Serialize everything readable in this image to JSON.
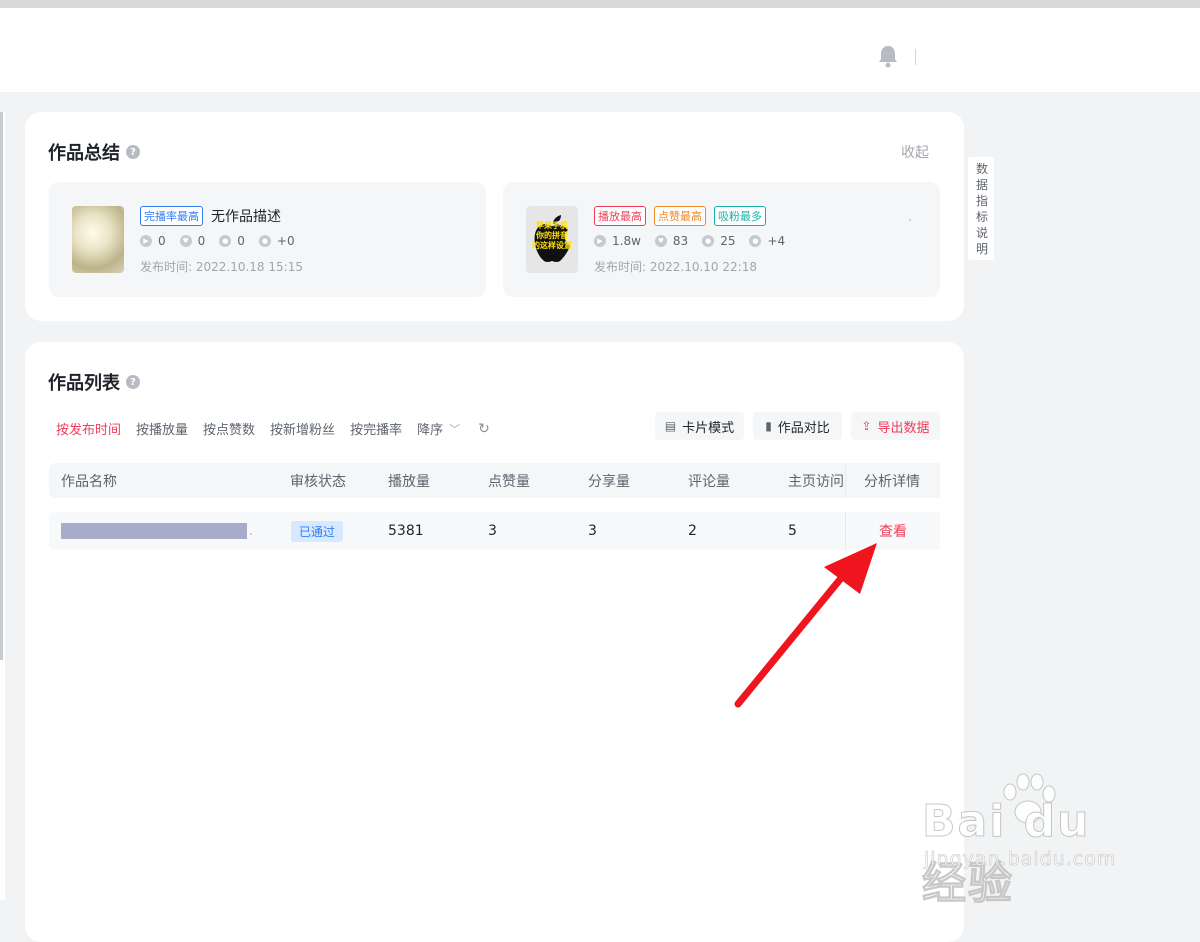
{
  "summary": {
    "title": "作品总结",
    "collapse_label": "收起",
    "works": [
      {
        "tags": [
          "完播率最高"
        ],
        "description": "无作品描述",
        "stats": {
          "plays": "0",
          "likes": "0",
          "comments": "0",
          "fans": "+0"
        },
        "publish_time": "发布时间: 2022.10.18 15:15"
      },
      {
        "tags": [
          "播放最高",
          "点赞最高",
          "吸粉最多"
        ],
        "thumbnail_text": "苹果手机 你的拼音 的这样设置",
        "stats": {
          "plays": "1.8w",
          "likes": "83",
          "comments": "25",
          "fans": "+4"
        },
        "publish_time": "发布时间: 2022.10.10 22:18",
        "trailing": "."
      }
    ]
  },
  "list": {
    "title": "作品列表",
    "filters": [
      "按发布时间",
      "按播放量",
      "按点赞数",
      "按新增粉丝",
      "按完播率"
    ],
    "sort_label": "降序",
    "buttons": {
      "card_mode": "卡片模式",
      "compare": "作品对比",
      "export": "导出数据"
    },
    "columns": [
      "作品名称",
      "审核状态",
      "播放量",
      "点赞量",
      "分享量",
      "评论量",
      "主页访问",
      "分析详情"
    ],
    "rows": [
      {
        "status": "已通过",
        "plays": "5381",
        "likes": "3",
        "shares": "3",
        "comments": "2",
        "visits": "5",
        "action": "查看",
        "trailing": "."
      }
    ]
  },
  "side_note": "数据指标说明",
  "watermark": {
    "main": "Bai du 经验",
    "sub": "jingyan.baidu.com"
  },
  "colors": {
    "accent": "#f03d5b",
    "badge_blue": "#2f7ef5",
    "arrow": "#f0141e"
  },
  "icons": [
    "bell-icon",
    "help-icon",
    "play-icon",
    "like-icon",
    "comment-icon",
    "fans-icon",
    "refresh-icon",
    "chevron-down-icon",
    "card-icon",
    "chart-icon",
    "export-icon"
  ]
}
